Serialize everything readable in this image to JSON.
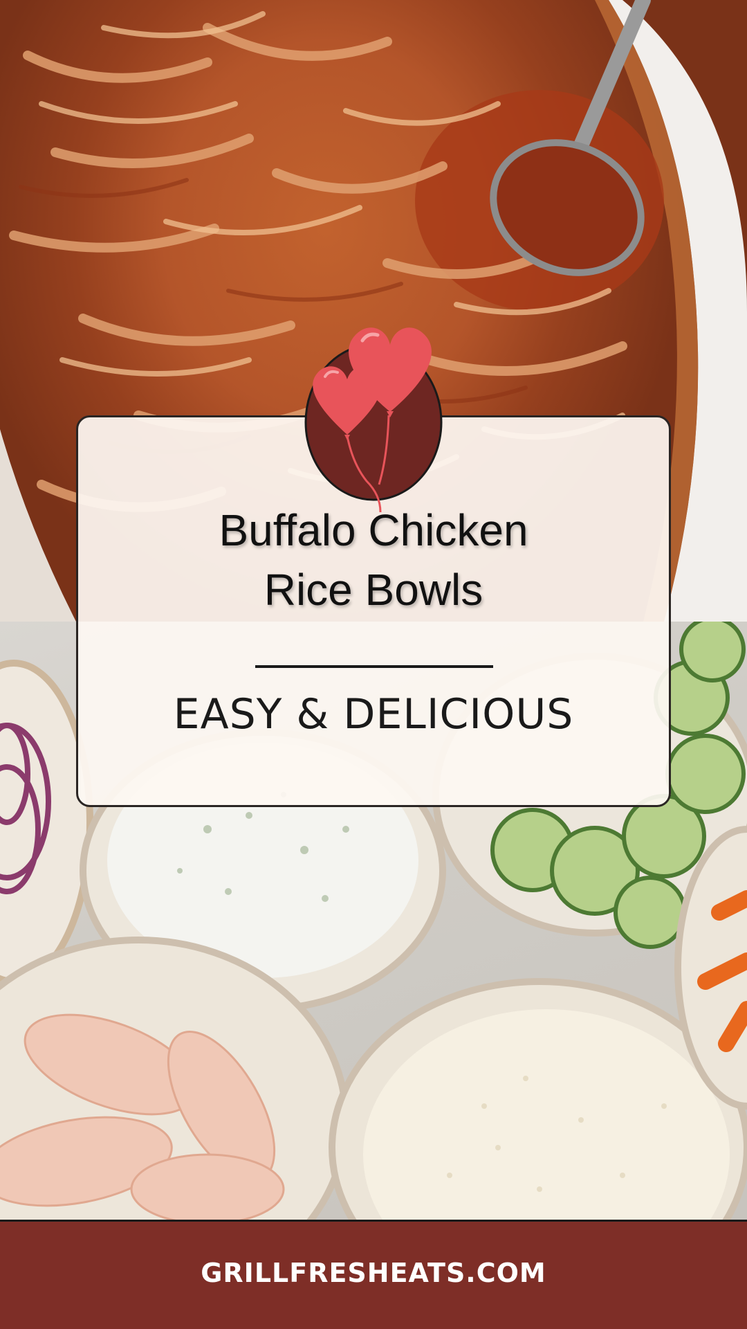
{
  "title": {
    "line1": "Buffalo Chicken",
    "line2": "Rice Bowls"
  },
  "subtitle": "EASY & DELICIOUS",
  "footer": {
    "website": "GRILLFRESHEATS.COM"
  },
  "colors": {
    "footer_background": "#7e2e27",
    "card_background": "#fdf8f2",
    "badge_background": "#6e2622",
    "balloon": "#e8545a"
  },
  "images": {
    "top_photo": "shredded-buffalo-chicken-in-slow-cooker",
    "bottom_photo": "ingredient-bowls-onion-ranch-cucumber-chicken-rice-carrot"
  },
  "icons": {
    "badge": "heart-balloons-icon"
  }
}
